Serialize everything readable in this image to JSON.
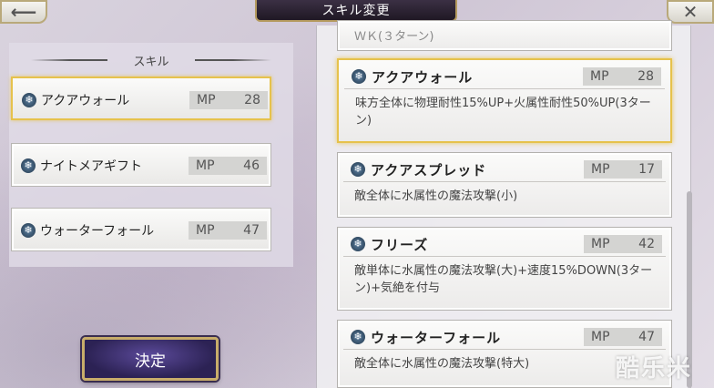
{
  "header": {
    "back_icon": "back-arrow-icon",
    "title": "スキル変更",
    "close_icon": "close-x-icon"
  },
  "left_panel": {
    "title": "スキル",
    "slots": [
      {
        "name": "アクアウォール",
        "mp_label": "MP",
        "mp": "28",
        "selected": true
      },
      {
        "name": "ナイトメアギフト",
        "mp_label": "MP",
        "mp": "46",
        "selected": false
      },
      {
        "name": "ウォーターフォール",
        "mp_label": "MP",
        "mp": "47",
        "selected": false
      }
    ],
    "confirm_label": "決定"
  },
  "skill_list": {
    "partial_top_text": "ＷＫ(３ターン)",
    "items": [
      {
        "name": "アクアウォール",
        "mp_label": "MP",
        "mp": "28",
        "desc": "味方全体に物理耐性15%UP+火属性耐性50%UP(3ターン)",
        "selected": true
      },
      {
        "name": "アクアスプレッド",
        "mp_label": "MP",
        "mp": "17",
        "desc": "敵全体に水属性の魔法攻撃(小)",
        "selected": false
      },
      {
        "name": "フリーズ",
        "mp_label": "MP",
        "mp": "42",
        "desc": "敵単体に水属性の魔法攻撃(大)+速度15%DOWN(3ターン)+気絶を付与",
        "selected": false
      },
      {
        "name": "ウォーターフォール",
        "mp_label": "MP",
        "mp": "47",
        "desc": "敵全体に水属性の魔法攻撃(特大)",
        "selected": false
      }
    ]
  },
  "skill_icon": "water-element-icon",
  "accent_color": "#e6c24c",
  "watermark": "酷乐米"
}
